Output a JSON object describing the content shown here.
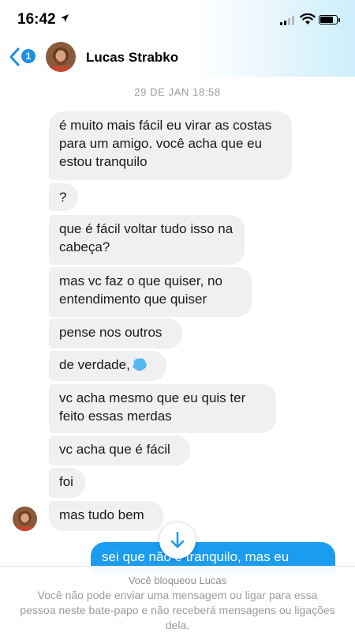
{
  "status_bar": {
    "time": "16:42"
  },
  "header": {
    "back_count": "1",
    "contact_name": "Lucas Strabko"
  },
  "conversation": {
    "timestamp": "29 DE JAN 18:58",
    "messages": [
      {
        "text": "é muito mais fácil eu virar as costas para um amigo. você acha que eu estou tranquilo"
      },
      {
        "text": "?"
      },
      {
        "text": "que é fácil voltar tudo isso na cabeça?"
      },
      {
        "text": "mas vc faz o que quiser, no entendimento que quiser"
      },
      {
        "text": "pense nos outros"
      },
      {
        "text": "de verdade,"
      },
      {
        "text": "vc acha mesmo que eu quis ter feito essas merdas"
      },
      {
        "text": "vc acha que é fácil"
      },
      {
        "text": "foi"
      },
      {
        "text": "mas tudo bem"
      }
    ],
    "sent_message": "sei que não é tranquilo, mas eu"
  },
  "footer": {
    "title": "Você bloqueou Lucas",
    "text": "Você não pode enviar uma mensagem ou ligar para essa pessoa neste bate-papo e não receberá mensagens ou ligações dela."
  },
  "colors": {
    "accent": "#1a9cf0",
    "incoming_bubble": "#f0f0f0",
    "badge": "#1e90e6"
  }
}
